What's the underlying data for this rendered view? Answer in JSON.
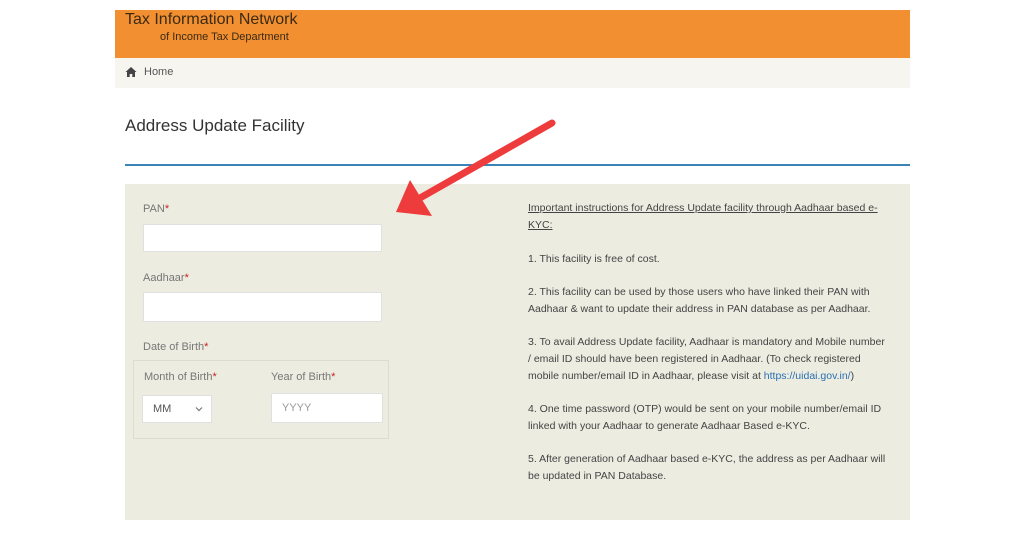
{
  "header": {
    "title_line1": "Tax Information Network",
    "title_line2": "of Income Tax Department",
    "accent_color": "#f28f31"
  },
  "breadcrumb": {
    "home_label": "Home",
    "icon": "home-icon"
  },
  "page": {
    "title": "Address Update Facility"
  },
  "form": {
    "pan_label": "PAN",
    "aadhaar_label": "Aadhaar",
    "required_mark": "*",
    "dob_label": "Date of Birth",
    "month_label": "Month of Birth",
    "year_label": "Year of Birth",
    "month_value": "MM",
    "year_placeholder": "YYYY",
    "pan_value": "",
    "aadhaar_value": ""
  },
  "instructions": {
    "heading": "Important instructions for Address Update facility through Aadhaar based e-KYC",
    "heading_suffix": ":",
    "item1": "1. This facility is free of cost.",
    "item2": "2. This facility can be used by those users who have linked their PAN with Aadhaar & want to update their address in PAN database as per Aadhaar.",
    "item3_text": "3. To avail Address Update facility, Aadhaar is mandatory and Mobile number / email ID should have been registered in Aadhaar. (To check registered mobile number/email ID in Aadhaar, please visit at ",
    "item3_link": "https://uidai.gov.in/",
    "item3_close": ")",
    "item4": "4. One time password (OTP) would be sent on your mobile number/email ID linked with your Aadhaar to generate Aadhaar Based e-KYC.",
    "item5": "5. After generation of Aadhaar based e-KYC, the address as per Aadhaar will be updated in PAN Database."
  },
  "annotation": {
    "arrow_color": "#ee3b3b"
  }
}
